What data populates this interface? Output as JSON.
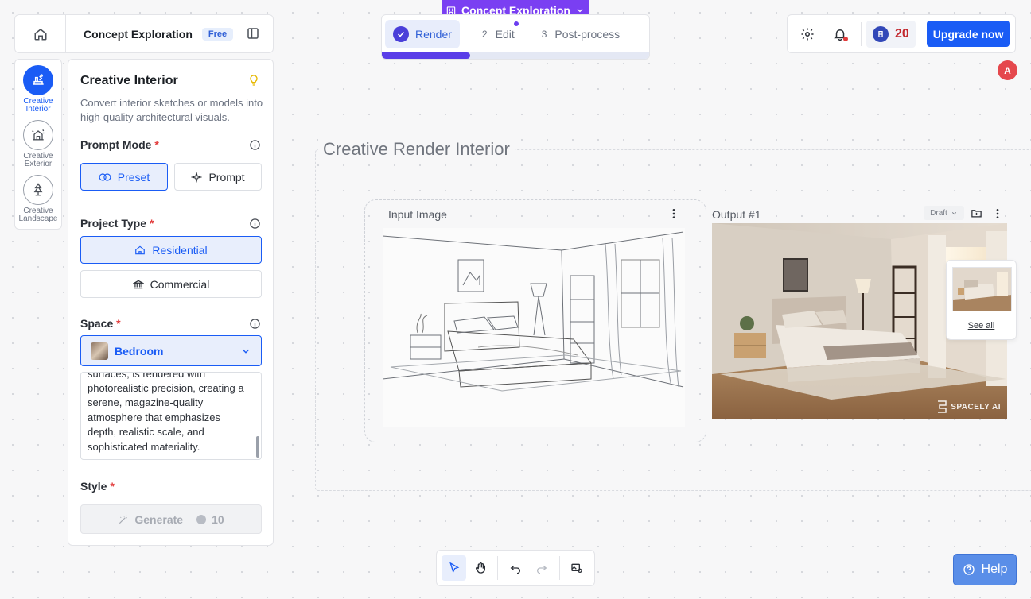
{
  "project": {
    "name": "Concept Exploration",
    "plan_badge": "Free"
  },
  "stepper": {
    "steps": [
      {
        "num": "",
        "label": "Render",
        "active": true
      },
      {
        "num": "2",
        "label": "Edit"
      },
      {
        "num": "3",
        "label": "Post-process"
      }
    ],
    "progress": 0.33
  },
  "header": {
    "credits": "20",
    "upgrade_label": "Upgrade now",
    "avatar_initial": "A"
  },
  "tools": [
    {
      "label": "Creative\nInterior",
      "icon": "interior-icon",
      "active": true
    },
    {
      "label": "Creative\nExterior",
      "icon": "exterior-icon"
    },
    {
      "label": "Creative\nLandscape",
      "icon": "landscape-icon"
    }
  ],
  "panel": {
    "title": "Creative Interior",
    "description": "Convert interior sketches or models into high-quality architectural visuals.",
    "prompt_mode": {
      "label": "Prompt Mode",
      "required": "*",
      "options": [
        "Preset",
        "Prompt"
      ],
      "selected": "Preset"
    },
    "project_type": {
      "label": "Project Type",
      "required": "*",
      "options": [
        "Residential",
        "Commercial"
      ],
      "selected": "Residential"
    },
    "space": {
      "label": "Space",
      "required": "*",
      "selected": "Bedroom"
    },
    "prompt_text": "surfaces, is rendered with photorealistic precision, creating a serene, magazine-quality atmosphere that emphasizes depth, realistic scale, and sophisticated materiality.",
    "style": {
      "label": "Style",
      "required": "*"
    },
    "generate": {
      "label": "Generate",
      "cost": "10"
    }
  },
  "canvas": {
    "frame_title": "Creative Render Interior",
    "input_label": "Input Image",
    "output_label": "Output #1",
    "output_status": "Draft",
    "watermark": "SPACELY AI",
    "see_all": "See all"
  },
  "help_label": "Help",
  "colors": {
    "primary": "#1a5cf5",
    "accent_purple": "#7a3ff2",
    "credits_red": "#c2272d"
  }
}
